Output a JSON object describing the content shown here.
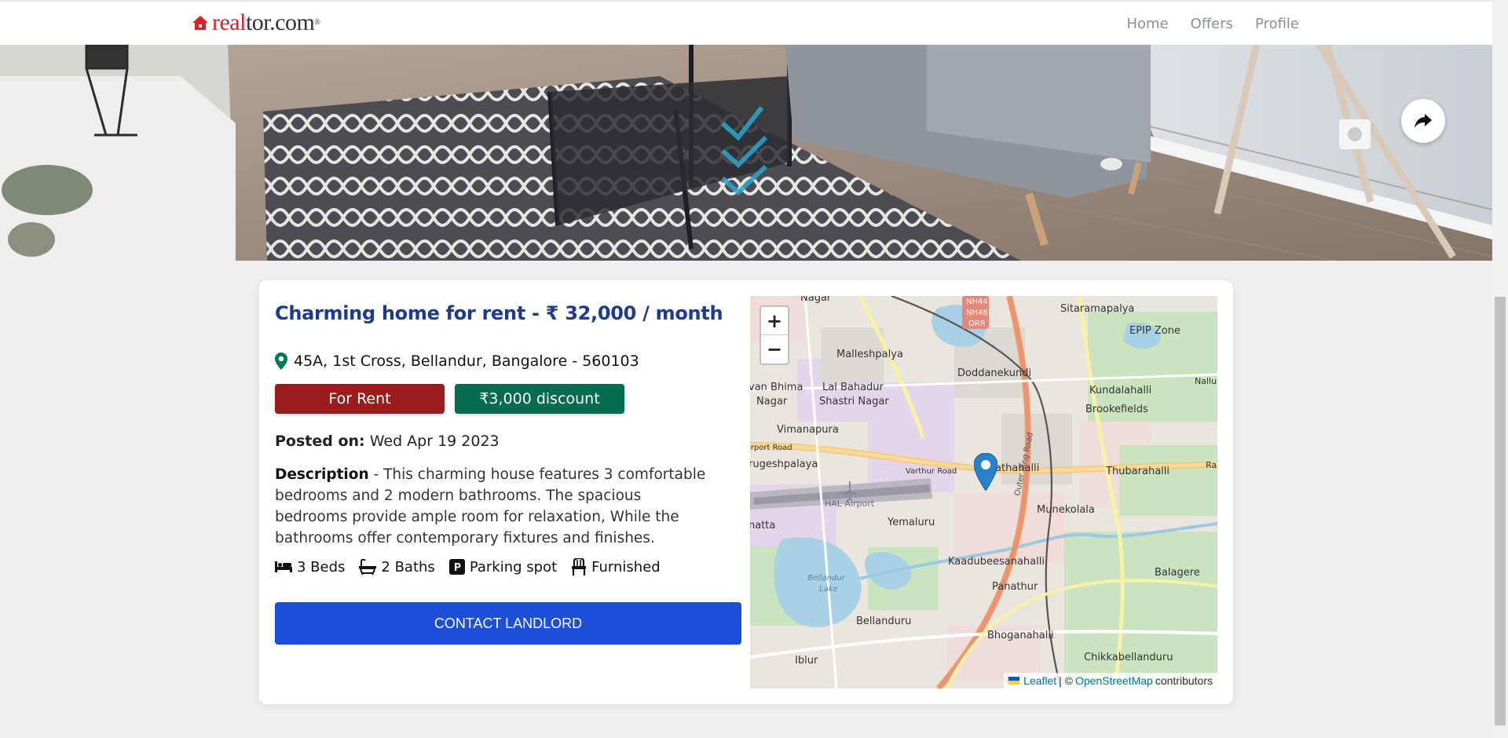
{
  "header": {
    "logo_real": "real",
    "logo_dot": "tor.com",
    "nav": [
      "Home",
      "Offers",
      "Profile"
    ]
  },
  "listing": {
    "title": "Charming home for rent - ₹ 32,000 / month",
    "address": "45A, 1st Cross, Bellandur, Bangalore - 560103",
    "badge_status": "For Rent",
    "badge_discount": "₹3,000 discount",
    "posted_label": "Posted on:",
    "posted_date": "Wed Apr 19 2023",
    "description_label": "Description",
    "description_text": " - This charming house features 3 comfortable bedrooms and 2 modern bathrooms. The spacious bedrooms provide ample room for relaxation, While the bathrooms offer contemporary fixtures and finishes.",
    "features": [
      {
        "icon": "bed-icon",
        "label": "3 Beds"
      },
      {
        "icon": "bath-icon",
        "label": "2 Baths"
      },
      {
        "icon": "parking-icon",
        "label": "Parking spot"
      },
      {
        "icon": "chair-icon",
        "label": "Furnished"
      }
    ],
    "contact_label": "CONTACT LANDLORD"
  },
  "map": {
    "zoom_in": "+",
    "zoom_out": "−",
    "attribution_leaflet": "Leaflet",
    "attribution_sep": "| ©",
    "attribution_osm": "OpenStreetMap",
    "attribution_suffix": "contributors",
    "places": [
      "Nagar",
      "Sitaramapalya",
      "EPIP Zone",
      "Malleshpalya",
      "Doddanekundi",
      "Nallur",
      "van Bhima",
      "Nagar",
      "Lal Bahadur",
      "Shastri Nagar",
      "Kundalahalli",
      "Brookefields",
      "Vimanapura",
      "irport Road",
      "rugeshpalaya",
      "Varthur Road",
      "athahalli",
      "Thubarahalli",
      "Ran",
      "HAL Airport",
      "Yemaluru",
      "Munekolala",
      "natta",
      "Kaadubeesanahalli",
      "Balagere",
      "Panathur",
      "Bellandur",
      "Lake",
      "Bellanduru",
      "Bhoganahalli",
      "Iblur",
      "Chikkabellanduru",
      "NH44",
      "NH48",
      "ORR",
      "Outer Ring Road"
    ]
  },
  "colors": {
    "title": "#1e3a8a",
    "rent_badge": "#9b1c1c",
    "discount_badge": "#046c4e",
    "contact_button": "#1d4ed8",
    "brand_red": "#d92228"
  }
}
